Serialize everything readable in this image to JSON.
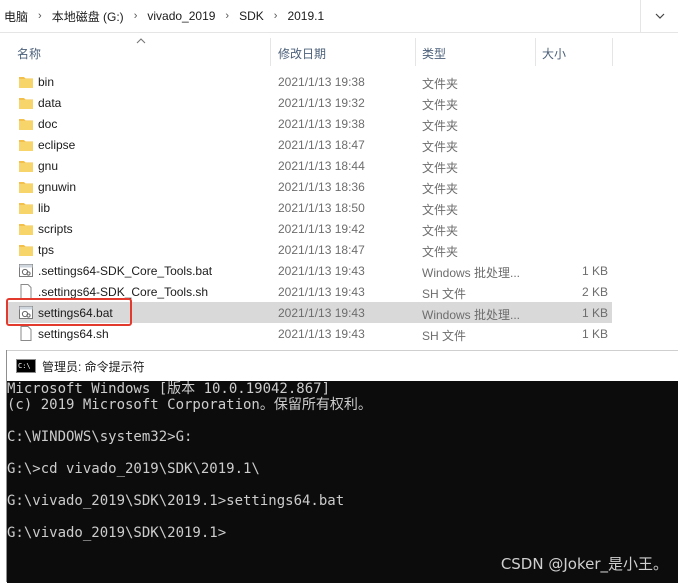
{
  "address": {
    "crumbs": [
      "电脑",
      "本地磁盘 (G:)",
      "vivado_2019",
      "SDK",
      "2019.1"
    ],
    "separator": "›"
  },
  "columns": {
    "name": "名称",
    "date": "修改日期",
    "type": "类型",
    "size": "大小"
  },
  "files": [
    {
      "name": "bin",
      "date": "2021/1/13 19:38",
      "type": "文件夹",
      "size": "",
      "icon": "folder-icon"
    },
    {
      "name": "data",
      "date": "2021/1/13 19:32",
      "type": "文件夹",
      "size": "",
      "icon": "folder-icon"
    },
    {
      "name": "doc",
      "date": "2021/1/13 19:38",
      "type": "文件夹",
      "size": "",
      "icon": "folder-icon"
    },
    {
      "name": "eclipse",
      "date": "2021/1/13 18:47",
      "type": "文件夹",
      "size": "",
      "icon": "folder-icon"
    },
    {
      "name": "gnu",
      "date": "2021/1/13 18:44",
      "type": "文件夹",
      "size": "",
      "icon": "folder-icon"
    },
    {
      "name": "gnuwin",
      "date": "2021/1/13 18:36",
      "type": "文件夹",
      "size": "",
      "icon": "folder-icon"
    },
    {
      "name": "lib",
      "date": "2021/1/13 18:50",
      "type": "文件夹",
      "size": "",
      "icon": "folder-icon"
    },
    {
      "name": "scripts",
      "date": "2021/1/13 19:42",
      "type": "文件夹",
      "size": "",
      "icon": "folder-icon"
    },
    {
      "name": "tps",
      "date": "2021/1/13 18:47",
      "type": "文件夹",
      "size": "",
      "icon": "folder-icon"
    },
    {
      "name": ".settings64-SDK_Core_Tools.bat",
      "date": "2021/1/13 19:43",
      "type": "Windows 批处理...",
      "size": "1 KB",
      "icon": "batch-file-icon"
    },
    {
      "name": ".settings64-SDK_Core_Tools.sh",
      "date": "2021/1/13 19:43",
      "type": "SH 文件",
      "size": "2 KB",
      "icon": "file-icon"
    },
    {
      "name": "settings64.bat",
      "date": "2021/1/13 19:43",
      "type": "Windows 批处理...",
      "size": "1 KB",
      "icon": "batch-file-icon",
      "selected": true
    },
    {
      "name": "settings64.sh",
      "date": "2021/1/13 19:43",
      "type": "SH 文件",
      "size": "1 KB",
      "icon": "file-icon"
    }
  ],
  "cmd": {
    "title": "管理员: 命令提示符",
    "icon_text": "C:\\",
    "lines": [
      "Microsoft Windows [版本 10.0.19042.867]",
      "(c) 2019 Microsoft Corporation。保留所有权利。",
      "",
      "C:\\WINDOWS\\system32>G:",
      "",
      "G:\\>cd vivado_2019\\SDK\\2019.1\\",
      "",
      "G:\\vivado_2019\\SDK\\2019.1>settings64.bat",
      "",
      "G:\\vivado_2019\\SDK\\2019.1>"
    ]
  },
  "watermark": "CSDN @Joker_是小王。",
  "colors": {
    "selected_row": "#d9d9d9",
    "highlight_box": "#e23a2c",
    "folder": "#f3c14b",
    "console_bg": "#0c0c0c"
  }
}
